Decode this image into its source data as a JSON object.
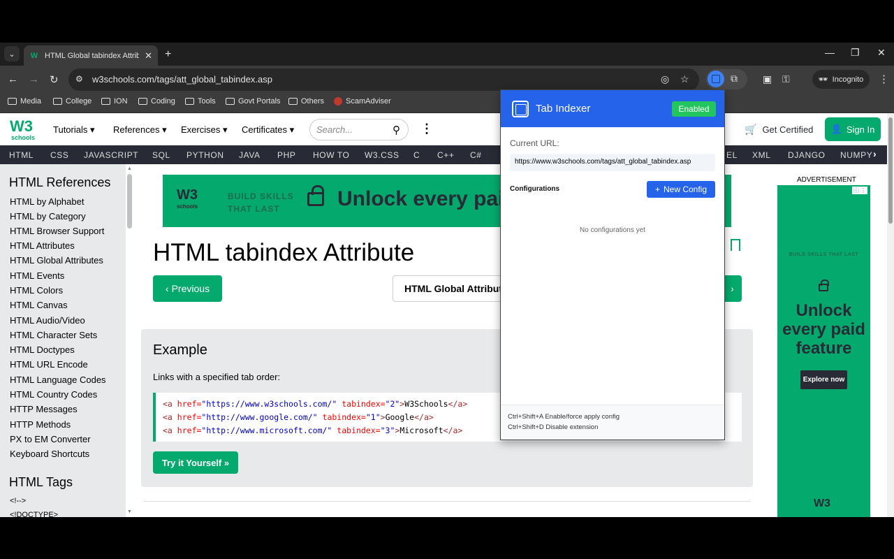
{
  "browser": {
    "tab_title": "HTML Global tabindex Attribute",
    "url": "w3schools.com/tags/att_global_tabindex.asp",
    "incognito_label": "Incognito",
    "bookmarks": [
      "Media",
      "College",
      "ION",
      "Coding",
      "Tools",
      "Govt Portals",
      "Others",
      "ScamAdviser"
    ]
  },
  "w3": {
    "logo_w3": "W3",
    "logo_schools": "schools",
    "topnav": [
      "Tutorials",
      "References",
      "Exercises",
      "Certificates"
    ],
    "search_placeholder": "Search...",
    "get_certified": "Get Certified",
    "sign_in": "Sign In",
    "langs_left": [
      "HTML",
      "CSS",
      "JAVASCRIPT",
      "SQL",
      "PYTHON",
      "JAVA",
      "PHP",
      "HOW TO",
      "W3.CSS",
      "C",
      "C++",
      "C#"
    ],
    "langs_right": [
      "EL",
      "XML",
      "DJANGO",
      "NUMPY"
    ]
  },
  "sidebar": {
    "heading1": "HTML References",
    "items": [
      "HTML by Alphabet",
      "HTML by Category",
      "HTML Browser Support",
      "HTML Attributes",
      "HTML Global Attributes",
      "HTML Events",
      "HTML Colors",
      "HTML Canvas",
      "HTML Audio/Video",
      "HTML Character Sets",
      "HTML Doctypes",
      "HTML URL Encode",
      "HTML Language Codes",
      "HTML Country Codes",
      "HTTP Messages",
      "HTTP Methods",
      "PX to EM Converter",
      "Keyboard Shortcuts"
    ],
    "heading2": "HTML Tags",
    "tags": [
      "<!-->",
      "<!DOCTYPE>"
    ]
  },
  "ad_banner": {
    "logo_w3": "W3",
    "logo_schools": "schools",
    "tagline": "BUILD SKILLS THAT LAST",
    "headline": "Unlock every paid"
  },
  "main": {
    "title": "HTML tabindex Attribute",
    "prev": "Previous",
    "mid": "HTML Global Attributes",
    "next": "›",
    "example_heading": "Example",
    "example_desc": "Links with a specified tab order:",
    "code": [
      {
        "href": "\"https://www.w3schools.com/\"",
        "tabindex": "\"2\"",
        "text": "W3Schools"
      },
      {
        "href": "\"http://www.google.com/\"",
        "tabindex": "\"1\"",
        "text": "Google"
      },
      {
        "href": "\"http://www.microsoft.com/\"",
        "tabindex": "\"3\"",
        "text": "Microsoft"
      }
    ],
    "try_it": "Try it Yourself »"
  },
  "side_ad": {
    "label": "ADVERTISEMENT",
    "tagline": "BUILD SKILLS THAT LAST",
    "headline": "Unlock every paid feature",
    "cta": "Explore now",
    "logo": "W3"
  },
  "popup": {
    "title": "Tab Indexer",
    "status": "Enabled",
    "current_url_label": "Current URL:",
    "current_url": "https://www.w3schools.com/tags/att_global_tabindex.asp",
    "configurations_label": "Configurations",
    "new_config": "New Config",
    "empty": "No configurations yet",
    "shortcut1": "Ctrl+Shift+A Enable/force apply config",
    "shortcut2": "Ctrl+Shift+D Disable extension"
  },
  "colors": {
    "w3_green": "#04aa6d",
    "popup_blue": "#2563eb",
    "enabled_green": "#22c55e"
  }
}
